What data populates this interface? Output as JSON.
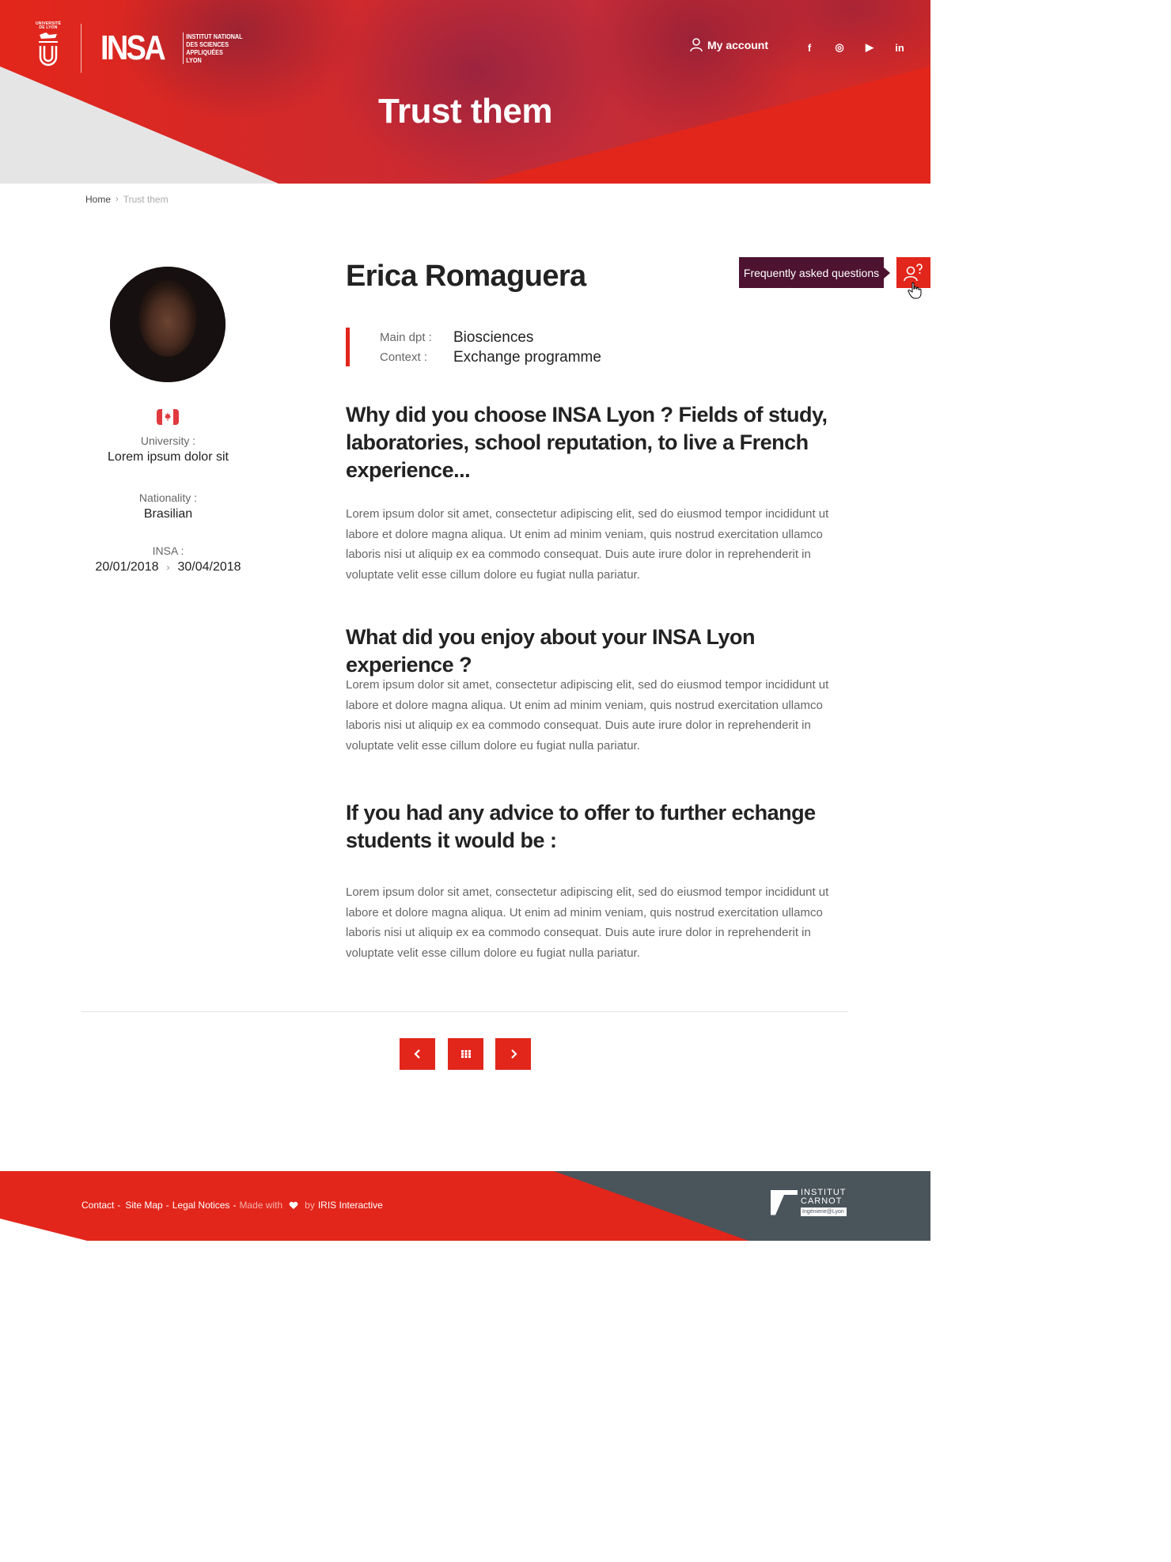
{
  "header": {
    "univ_logo_text": "UNIVERSITÉ DE LYON",
    "insa_logo": "INSA",
    "insa_subtitle": [
      "INSTITUT NATIONAL",
      "DES SCIENCES",
      "APPLIQUÉES",
      "LYON"
    ],
    "my_account": "My account",
    "socials": [
      "facebook-icon",
      "instagram-icon",
      "youtube-icon",
      "linkedin-icon"
    ],
    "social_glyphs": [
      "f",
      "◎",
      "▶",
      "in"
    ],
    "page_title": "Trust them"
  },
  "breadcrumb": {
    "home": "Home",
    "separator": "›",
    "current": "Trust them"
  },
  "profile": {
    "name": "Erica Romaguera",
    "flag_colors": [
      "#e03a3e",
      "#ffffff",
      "#e03a3e"
    ],
    "flag_glyph": "🍁",
    "university_label": "University :",
    "university_value": "Lorem ipsum dolor sit",
    "nationality_label": "Nationality :",
    "nationality_value": "Brasilian",
    "insa_label": "INSA :",
    "date_from": "20/01/2018",
    "date_to": "30/04/2018",
    "date_sep": "›",
    "main_dpt_label": "Main dpt :",
    "main_dpt_value": "Biosciences",
    "context_label": "Context :",
    "context_value": "Exchange programme"
  },
  "content": {
    "q1": "Why did you choose INSA Lyon ? Fields of study, laboratories, school reputation, to live a French experience...",
    "a1": "Lorem ipsum dolor sit amet, consectetur adipiscing elit, sed do eiusmod tempor incididunt ut labore et dolore magna aliqua. Ut enim ad minim veniam, quis nostrud exercitation ullamco laboris nisi ut aliquip ex ea commodo consequat. Duis aute irure dolor in reprehenderit in voluptate velit esse cillum dolore eu fugiat nulla pariatur.",
    "q2": "What did you enjoy about your INSA Lyon experience ?",
    "a2": "Lorem ipsum dolor sit amet, consectetur adipiscing elit, sed do eiusmod tempor incididunt ut labore et dolore magna aliqua. Ut enim ad minim veniam, quis nostrud exercitation ullamco laboris nisi ut aliquip ex ea commodo consequat. Duis aute irure dolor in reprehenderit in voluptate velit esse cillum dolore eu fugiat nulla pariatur.",
    "q3": "If you had any advice to offer to further echange students it would be :",
    "a3": "Lorem ipsum dolor sit amet, consectetur adipiscing elit, sed do eiusmod tempor incididunt ut labore et dolore magna aliqua. Ut enim ad minim veniam, quis nostrud exercitation ullamco laboris nisi ut aliquip ex ea commodo consequat. Duis aute irure dolor in reprehenderit in voluptate velit esse cillum dolore eu fugiat nulla pariatur."
  },
  "faq": {
    "label": "Frequently asked questions"
  },
  "pagination": {
    "prev_icon": "chevron-left-icon",
    "grid_icon": "grid-icon",
    "next_icon": "chevron-right-icon"
  },
  "footer": {
    "contact": "Contact",
    "site_map": "Site Map",
    "legal": "Legal Notices",
    "made_with": "Made with",
    "by": "by",
    "agency": "IRIS Interactive",
    "dash": "-",
    "carnot_line1": "INSTITUT",
    "carnot_line2": "CARNOT",
    "carnot_tag": "Ingénierie@Lyon"
  },
  "colors": {
    "brand_red": "#e2261b",
    "faq_purple": "#4e1331",
    "footer_grey": "#4a545b"
  }
}
